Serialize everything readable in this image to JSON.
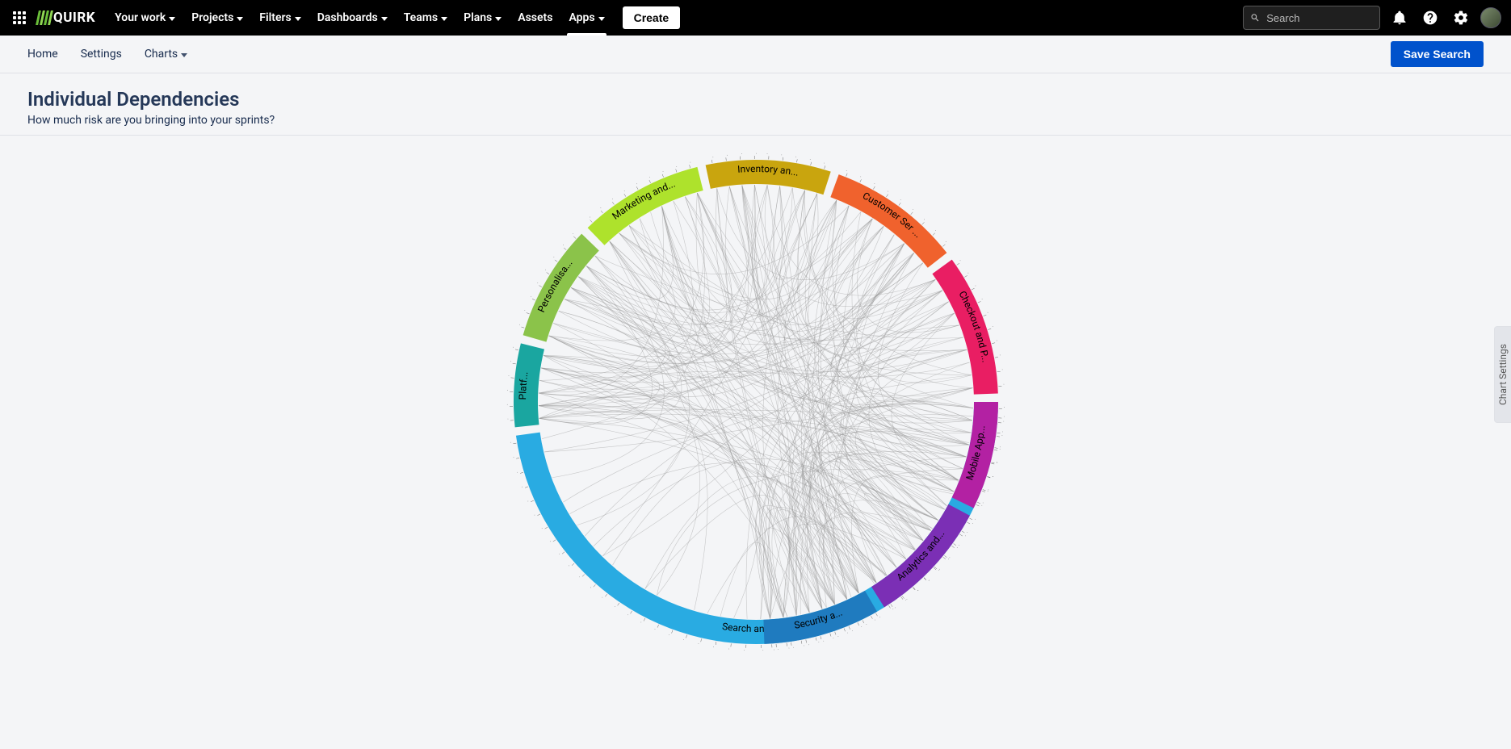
{
  "brand": "QUIRK",
  "topnav": {
    "items": [
      {
        "label": "Your work",
        "dropdown": true
      },
      {
        "label": "Projects",
        "dropdown": true
      },
      {
        "label": "Filters",
        "dropdown": true
      },
      {
        "label": "Dashboards",
        "dropdown": true
      },
      {
        "label": "Teams",
        "dropdown": true
      },
      {
        "label": "Plans",
        "dropdown": true
      },
      {
        "label": "Assets",
        "dropdown": false
      },
      {
        "label": "Apps",
        "dropdown": true,
        "active": true
      }
    ],
    "create_label": "Create",
    "search_placeholder": "Search"
  },
  "subnav": {
    "items": [
      {
        "label": "Home"
      },
      {
        "label": "Settings"
      },
      {
        "label": "Charts",
        "dropdown": true
      }
    ],
    "save_label": "Save Search"
  },
  "page": {
    "title": "Individual Dependencies",
    "subtitle": "How much risk are you bringing into your sprints?"
  },
  "side_tab": "Chart Settings",
  "chart_data": {
    "type": "chord",
    "title": "Individual Dependencies",
    "inner_radius": 270,
    "outer_radius": 300,
    "gap_deg": 2,
    "ticks_per_group": "proportional, approx 6 per 20° of arc",
    "groups": [
      {
        "name": "Search and Discovery",
        "label": "Search and Discovery",
        "color": "#29abe2",
        "start_deg": 92,
        "end_deg": 262,
        "ticks": 48
      },
      {
        "name": "Platf...",
        "label": "Platf...",
        "color": "#1aa6a0",
        "start_deg": 264,
        "end_deg": 284,
        "ticks": 6
      },
      {
        "name": "Personalisa...",
        "label": "Personalisa...",
        "color": "#8bc34a",
        "start_deg": 286,
        "end_deg": 314,
        "ticks": 8
      },
      {
        "name": "Marketing and...",
        "label": "Marketing and...",
        "color": "#aee22c",
        "start_deg": 316,
        "end_deg": 346,
        "ticks": 9
      },
      {
        "name": "Inventory an...",
        "label": "Inventory an...",
        "color": "#c9a50e",
        "start_deg": 348,
        "end_deg": 378,
        "ticks": 9
      },
      {
        "name": "Customer Ser ...",
        "label": "Customer Ser ...",
        "color": "#f0622d",
        "start_deg": 380,
        "end_deg": 412,
        "ticks": 9
      },
      {
        "name": "Checkout and P...",
        "label": "Checkout and P...",
        "color": "#e91e63",
        "start_deg": 414,
        "end_deg": 448,
        "ticks": 10
      },
      {
        "name": "Mobile App...",
        "label": "Mobile App...",
        "color": "#b321a3",
        "start_deg": 450,
        "end_deg": 476,
        "ticks": 8
      },
      {
        "name": "Analytics and...",
        "label": "Analytics and...",
        "color": "#7b2fb5",
        "start_deg": 478,
        "end_deg": 508,
        "ticks": 9
      },
      {
        "name": "Security a...",
        "label": "Security a...",
        "color": "#1f7bbf",
        "start_deg": 510,
        "end_deg": 538,
        "ticks": 8
      }
    ],
    "links_note": "Dense many-to-many grey dependency lines between ticks of all groups, visually ~250 connections. Rendered procedurally as random pairings across groups."
  }
}
